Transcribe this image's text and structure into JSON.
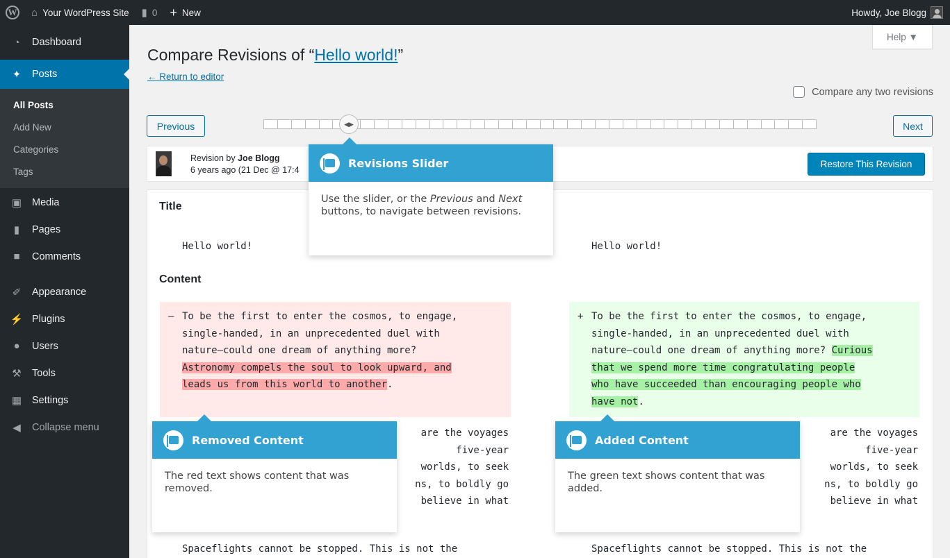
{
  "adminbar": {
    "site_name": "Your WordPress Site",
    "comments_count": "0",
    "new_label": "New",
    "howdy": "Howdy, Joe Blogg"
  },
  "sidebar": {
    "items": [
      {
        "label": "Dashboard",
        "icon": "dashboard-icon"
      },
      {
        "label": "Posts",
        "icon": "pin-icon"
      },
      {
        "label": "Media",
        "icon": "media-icon"
      },
      {
        "label": "Pages",
        "icon": "pages-icon"
      },
      {
        "label": "Comments",
        "icon": "comment-icon"
      },
      {
        "label": "Appearance",
        "icon": "brush-icon"
      },
      {
        "label": "Plugins",
        "icon": "plugin-icon"
      },
      {
        "label": "Users",
        "icon": "user-icon"
      },
      {
        "label": "Tools",
        "icon": "wrench-icon"
      },
      {
        "label": "Settings",
        "icon": "settings-icon"
      },
      {
        "label": "Collapse menu",
        "icon": "collapse-icon"
      }
    ],
    "submenu": [
      "All Posts",
      "Add New",
      "Categories",
      "Tags"
    ]
  },
  "main": {
    "title_prefix": "Compare Revisions of “",
    "title_link": "Hello world!",
    "title_suffix": "”",
    "return_link": "← Return to editor",
    "help": "Help ▼",
    "compare_two": "Compare any two revisions",
    "prev": "Previous",
    "next": "Next",
    "revision_by": "Revision by",
    "author": "Joe Blogg",
    "revision_date": "6 years ago (21 Dec @ 17:4",
    "restore": "Restore This Revision"
  },
  "diff": {
    "title_heading": "Title",
    "content_heading": "Content",
    "title_old": "Hello world!",
    "title_new": "Hello world!",
    "removed_sign": "–",
    "added_sign": "+",
    "left_lines": [
      "To be the first to enter the cosmos, to engage,",
      "single-handed, in an unprecedented duel with",
      "nature—could one dream of anything more?"
    ],
    "left_removed": [
      "Astronomy compels the soul to look upward, and",
      "leads us from this world to another"
    ],
    "right_lines": [
      "To be the first to enter the cosmos, to engage,",
      "single-handed, in an unprecedented duel with",
      "nature—could one dream of anything more?"
    ],
    "right_added": [
      "Curious",
      "that we spend more time congratulating people",
      "who have succeeded than encouraging people who",
      "have not"
    ],
    "para2_visible": [
      "are the voyages",
      "five-year",
      "worlds, to seek",
      "ns, to boldly go",
      "believe in what"
    ],
    "para3": "Spaceflights cannot be stopped. This is not the"
  },
  "pointers": {
    "slider": {
      "title": "Revisions Slider",
      "body_a": "Use the slider, or the ",
      "body_prev": "Previous",
      "body_b": " and ",
      "body_next": "Next",
      "body_c": " buttons, to navigate between revisions."
    },
    "removed": {
      "title": "Removed Content",
      "body": "The red text shows content that was removed."
    },
    "added": {
      "title": "Added Content",
      "body": "The green text shows content that was added."
    }
  }
}
